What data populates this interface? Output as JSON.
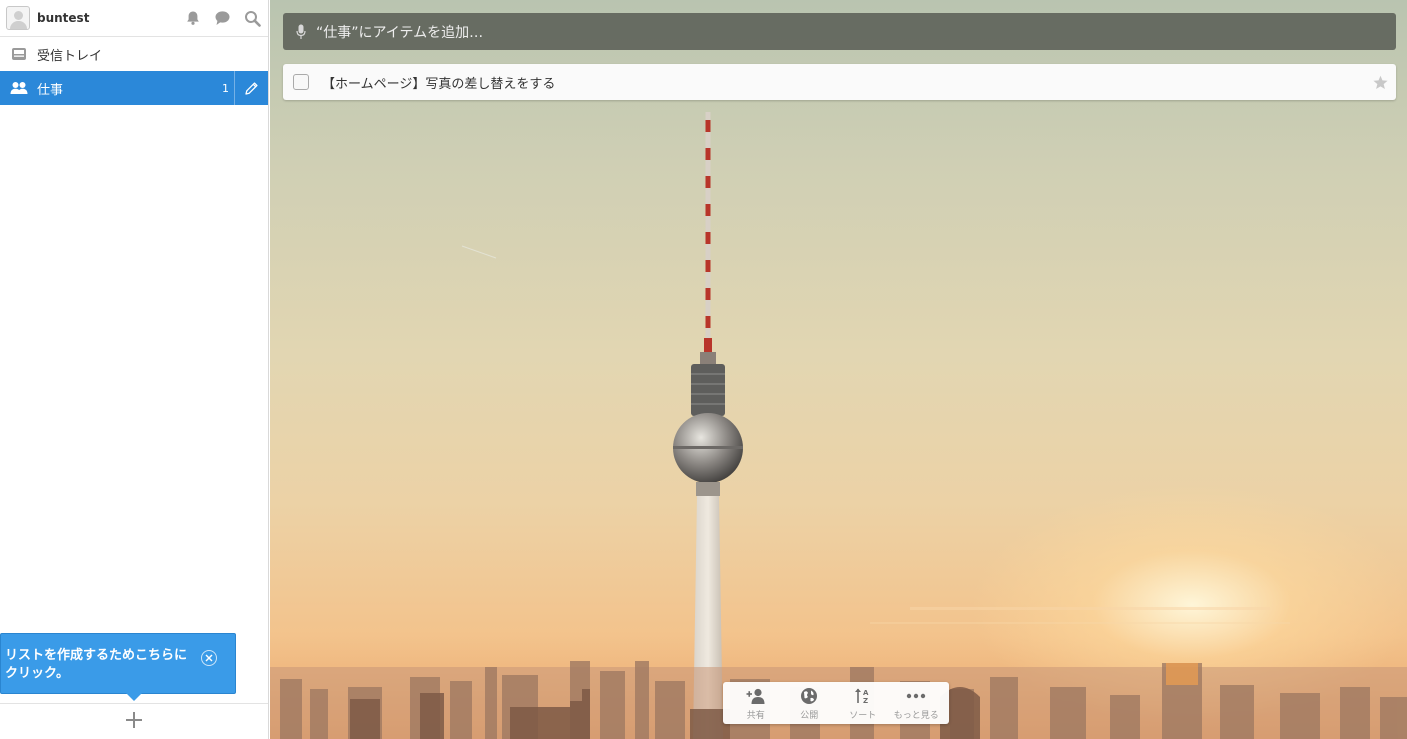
{
  "user": {
    "name": "buntest"
  },
  "top_icons": [
    "bell-icon",
    "chat-bubble-icon",
    "search-icon"
  ],
  "sidebar": {
    "items": [
      {
        "label": "受信トレイ",
        "icon": "inbox-icon",
        "count": ""
      },
      {
        "label": "仕事",
        "icon": "shared-users-icon",
        "count": "1",
        "active": true
      }
    ],
    "tooltip": {
      "text": "リストを作成するためこちらにクリック。"
    },
    "footer_icon": "plus-icon"
  },
  "main": {
    "add_placeholder": "“仕事”にアイテムを追加…",
    "tasks": [
      {
        "label": "【ホームページ】写真の差し替えをする",
        "starred": false
      }
    ],
    "toolbar": [
      {
        "label": "共有",
        "icon": "add-person-icon"
      },
      {
        "label": "公開",
        "icon": "globe-icon"
      },
      {
        "label": "ソート",
        "icon": "sort-az-icon"
      },
      {
        "label": "もっと見る",
        "icon": "more-dots-icon"
      }
    ]
  },
  "colors": {
    "accent": "#2b88d9",
    "tooltip": "#3a9be8"
  }
}
